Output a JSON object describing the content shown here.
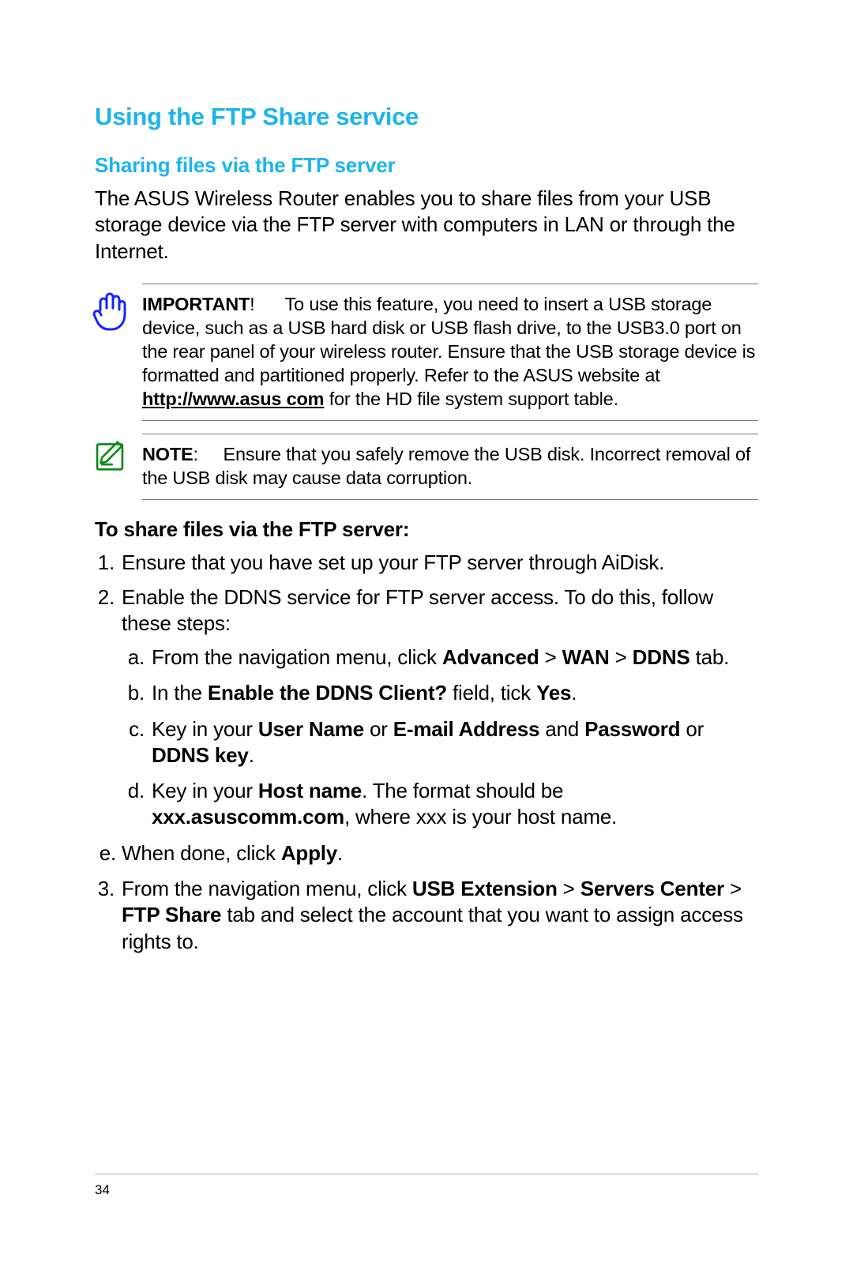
{
  "heading_main": "Using the FTP Share service",
  "heading_sub": "Sharing files via the FTP server",
  "intro": "The ASUS Wireless Router enables you to share files from your USB storage device via the FTP server with computers in LAN or through the Internet.",
  "important": {
    "label": "IMPORTANT",
    "bang": "!",
    "text1": "To use this feature, you need to insert a USB storage device, such as a USB hard disk or USB  flash drive, to the USB3.0 port on the rear panel of your wireless router. Ensure that the USB storage device is formatted and partitioned properly. Refer to the ASUS website at ",
    "link": "http://www.asus com",
    "text2": " for the HD file system support table."
  },
  "note": {
    "label": "NOTE",
    "colon": ":",
    "text": "Ensure that you safely remove the USB disk. Incorrect removal of the USB disk may cause data corruption."
  },
  "steps_heading": "To share files via the FTP server:",
  "step1": "Ensure that you have set up your FTP server through AiDisk.",
  "step2_lead": "Enable the DDNS service for FTP server access. To do this, follow these steps:",
  "step2a_pre": "From the navigation menu, click ",
  "step2a_b1": "Advanced",
  "step2a_sep1": " > ",
  "step2a_b2": "WAN",
  "step2a_sep2": " > ",
  "step2a_b3": "DDNS",
  "step2a_post": " tab.",
  "step2b_pre": "In the ",
  "step2b_b1": "Enable the DDNS Client?",
  "step2b_mid": " field, tick ",
  "step2b_b2": "Yes",
  "step2b_post": ".",
  "step2c_pre": "Key in your ",
  "step2c_b1": "User Name",
  "step2c_mid1": " or ",
  "step2c_b2": "E-mail Address",
  "step2c_mid2": " and ",
  "step2c_b3": "Password",
  "step2c_mid3": " or ",
  "step2c_b4": "DDNS key",
  "step2c_post": ".",
  "step2d_pre": "Key in your ",
  "step2d_b1": "Host name",
  "step2d_mid1": ". The format should be ",
  "step2d_b2": "xxx.asuscomm.com",
  "step2d_post": ", where xxx is your host name.",
  "step2e_pre": "When done, click ",
  "step2e_b1": "Apply",
  "step2e_post": ".",
  "step3_pre": "From the navigation menu, click ",
  "step3_b1": "USB Extension",
  "step3_sep1": " > ",
  "step3_b2": "Servers Center",
  "step3_sep2": " > ",
  "step3_b3": "FTP Share",
  "step3_post": " tab and select the account that you want to assign access rights to.",
  "page_number": "34"
}
